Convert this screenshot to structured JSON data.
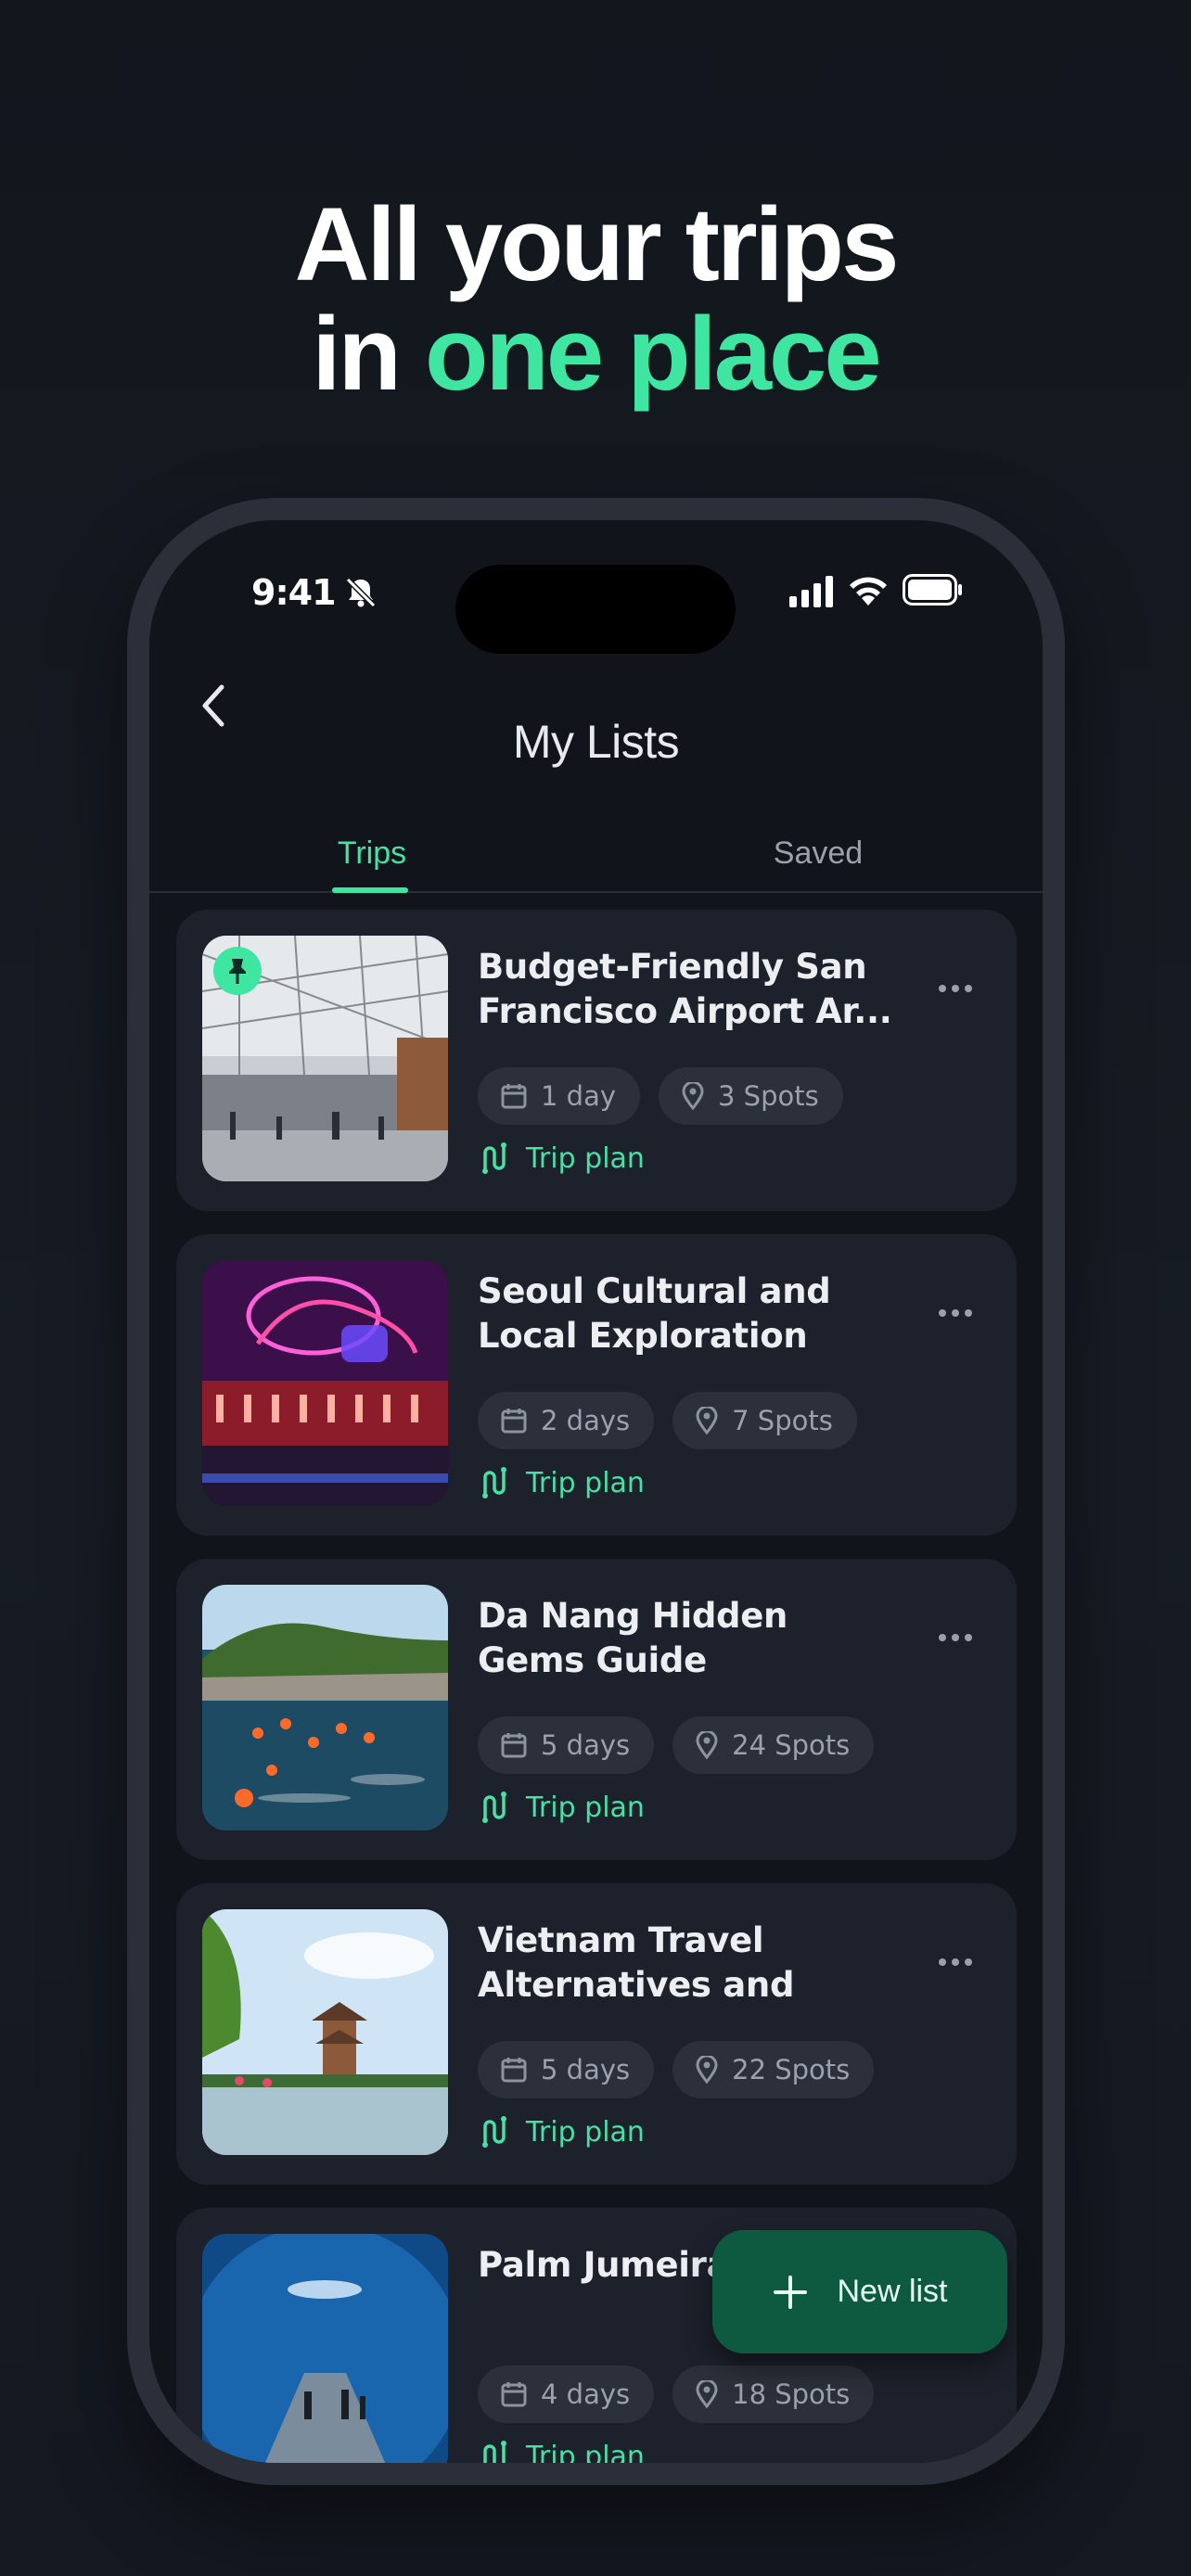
{
  "headline": {
    "line1": "All your trips",
    "line2_prefix": "in ",
    "line2_accent": "one place"
  },
  "status_bar": {
    "time": "9:41"
  },
  "nav": {
    "title": "My Lists"
  },
  "tabs": [
    {
      "label": "Trips",
      "active": true
    },
    {
      "label": "Saved",
      "active": false
    }
  ],
  "trips": [
    {
      "title": "Budget-Friendly San Francisco Airport Ar...",
      "duration": "1 day",
      "spots": "3 Spots",
      "type": "Trip plan",
      "pinned": true,
      "image": "airport-terminal-photo"
    },
    {
      "title": "Seoul Cultural and Local Exploration",
      "duration": "2 days",
      "spots": "7 Spots",
      "type": "Trip plan",
      "pinned": false,
      "image": "neon-bar-photo"
    },
    {
      "title": "Da Nang Hidden Gems Guide",
      "duration": "5 days",
      "spots": "24 Spots",
      "type": "Trip plan",
      "pinned": false,
      "image": "island-swimmers-photo"
    },
    {
      "title": "Vietnam Travel Alternatives and Hig...",
      "duration": "5 days",
      "spots": "22 Spots",
      "type": "Trip plan",
      "pinned": false,
      "image": "pagoda-lake-photo"
    },
    {
      "title": "Palm Jumeira",
      "duration": "4 days",
      "spots": "18 Spots",
      "type": "Trip plan",
      "pinned": false,
      "image": "aquarium-tunnel-photo"
    }
  ],
  "fab": {
    "label": "New list"
  },
  "colors": {
    "accent": "#3ee6a2",
    "background": "#141820",
    "card": "#1d212c",
    "fab": "#0e5a41"
  }
}
